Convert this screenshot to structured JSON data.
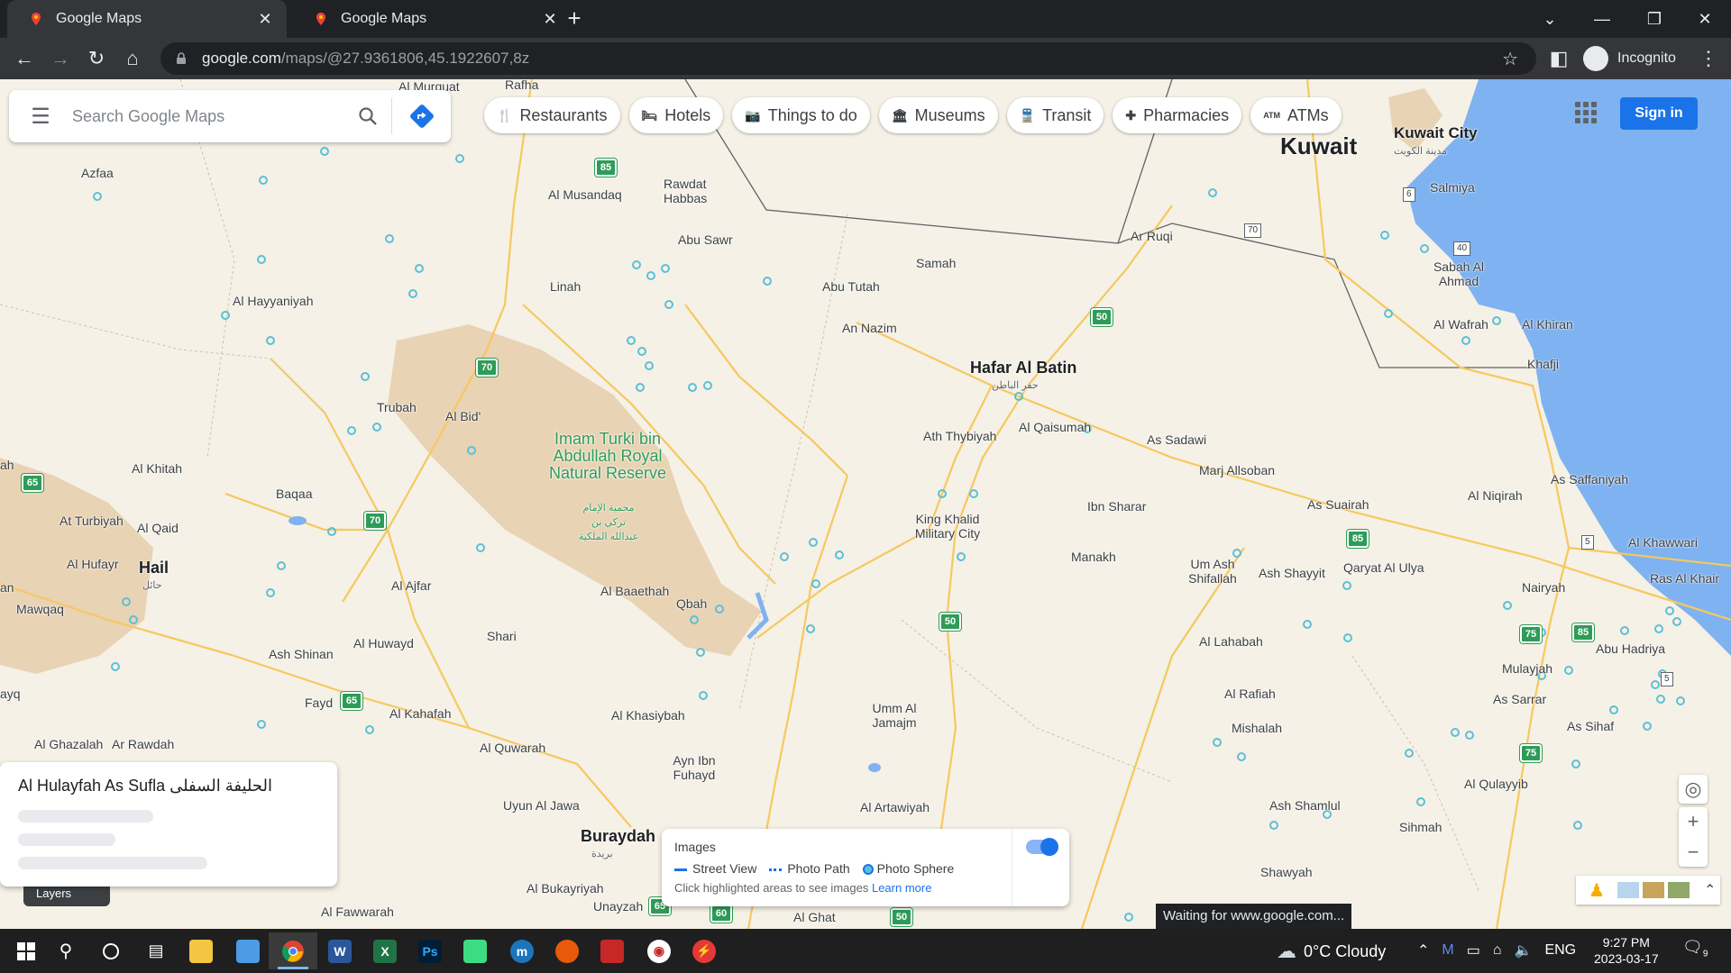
{
  "tabs": [
    {
      "title": "Google Maps",
      "active": true
    },
    {
      "title": "Google Maps",
      "active": false
    }
  ],
  "address": {
    "host": "google.com",
    "path": "/maps/@27.9361806,45.1922607,8z"
  },
  "profile": {
    "label": "Incognito"
  },
  "search": {
    "placeholder": "Search Google Maps"
  },
  "chips": [
    {
      "label": "Restaurants",
      "icon": "restaurant-icon",
      "glyph": "🍴"
    },
    {
      "label": "Hotels",
      "icon": "hotel-icon",
      "glyph": "🛏"
    },
    {
      "label": "Things to do",
      "icon": "camera-icon",
      "glyph": "📷"
    },
    {
      "label": "Museums",
      "icon": "museum-icon",
      "glyph": "🏛"
    },
    {
      "label": "Transit",
      "icon": "transit-icon",
      "glyph": "🚆"
    },
    {
      "label": "Pharmacies",
      "icon": "pharmacy-icon",
      "glyph": "✚"
    },
    {
      "label": "ATMs",
      "icon": "atm-icon",
      "glyph": "ATM"
    }
  ],
  "signin": {
    "label": "Sign in"
  },
  "map": {
    "labels": {
      "kuwait": "Kuwait",
      "kuwait_city": "Kuwait City",
      "kuwait_city_ar": "مدينة الكويت",
      "salmiya": "Salmiya",
      "hafar": "Hafar Al Batin",
      "hafar_ar": "حفر الباطن",
      "buraydah": "Buraydah",
      "buraydah_ar": "بريدة",
      "hail": "Hail",
      "hail_ar": "حائل",
      "park": "Imam Turki bin Abdullah Royal Natural Reserve",
      "park_ar": "محمية الإمام تركي بن عبدالله الملكية",
      "al_musandaq": "Al Musandaq",
      "rawdat_habbas": "Rawdat Habbas",
      "abu_sawr": "Abu Sawr",
      "linah": "Linah",
      "abu_tutah": "Abu Tutah",
      "samah": "Samah",
      "an_nazim": "An Nazim",
      "ar_ruqi": "Ar Ruqi",
      "al_qaisumah": "Al Qaisumah",
      "ath_thybiyah": "Ath Thybiyah",
      "as_sadawi": "As Sadawi",
      "marj_allsoban": "Marj Allsoban",
      "king_khalid": "King Khalid Military City",
      "ibn_sharar": "Ibn Sharar",
      "manakh": "Manakh",
      "um_ash_shifallah": "Um Ash Shifallah",
      "ash_shayyit": "Ash Shayyit",
      "qaryat_al_ulya": "Qaryat Al Ulya",
      "as_suairah": "As Suairah",
      "al_niqirah": "Al Niqirah",
      "as_saffaniyah": "As Saffaniyah",
      "al_khawwari": "Al Khawwari",
      "ras_al_khair": "Ras Al Khair",
      "nairyah": "Nairyah",
      "abu_hadriya": "Abu Hadriya",
      "mulayjah": "Mulayjah",
      "as_sarrar": "As Sarrar",
      "as_sihaf": "As Sihaf",
      "al_qulayyib": "Al Qulayyib",
      "sihmah": "Sihmah",
      "ash_shamlul": "Ash Shamlul",
      "shawyah": "Shawyah",
      "mishalah": "Mishalah",
      "al_rafiah": "Al Rafiah",
      "al_lahabah": "Al Lahabah",
      "umm_al_jamajm": "Umm Al Jamajm",
      "al_artawiyah": "Al Artawiyah",
      "al_ghat": "Al Ghat",
      "ayn_ibn_fuhayd": "Ayn Ibn Fuhayd",
      "al_khasiybah": "Al Khasiybah",
      "qbah": "Qbah",
      "al_baaethah": "Al Baaethah",
      "shari": "Shari",
      "al_quwarah": "Al Quwarah",
      "uyun_al_jawa": "Uyun Al Jawa",
      "al_bukayriyah": "Al Bukayriyah",
      "unayzah": "Unayzah",
      "al_fawwarah": "Al Fawwarah",
      "al_kahafah": "Al Kahafah",
      "fayd": "Fayd",
      "ash_shinan": "Ash Shinan",
      "al_huwayd": "Al Huwayd",
      "al_ajfar": "Al Ajfar",
      "baqaa": "Baqaa",
      "trubah": "Trubah",
      "al_bid": "Al Bid'",
      "al_khitah": "Al Khitah",
      "at_turbiyah": "At Turbiyah",
      "al_qaid": "Al Qaid",
      "al_hufayr": "Al Hufayr",
      "mawqaq": "Mawqaq",
      "al_ghazalah": "Al Ghazalah",
      "ar_rawdah": "Ar Rawdah",
      "azfaa": "Azfaa",
      "al_hayyaniyah": "Al Hayyaniyah",
      "al_murquat": "Al Murquat",
      "rafha": "Rafha",
      "sabah_al_ahmad": "Sabah Al Ahmad",
      "al_wafrah": "Al Wafrah",
      "al_khiran": "Al Khiran",
      "khafji": "Khafji",
      "hayq": "ayq",
      "ah": "ah",
      "an": "an"
    },
    "shields": [
      "85",
      "70",
      "70",
      "65",
      "65",
      "50",
      "50",
      "85",
      "85",
      "75",
      "75",
      "65",
      "60",
      "50"
    ],
    "boxes": [
      "70",
      "40",
      "6",
      "5",
      "5"
    ]
  },
  "placecard": {
    "title": "Al Hulayfah As Sufla الحليفة السفلى"
  },
  "layers": {
    "label": "Layers"
  },
  "images_panel": {
    "title": "Images",
    "legend": [
      "Street View",
      "Photo Path",
      "Photo Sphere"
    ],
    "hint": "Click highlighted areas to see images",
    "learn_more": "Learn more",
    "toggle_on": true
  },
  "status_bar": {
    "text": "Waiting for www.google.com..."
  },
  "taskbar": {
    "weather": "0°C  Cloudy",
    "language": "ENG",
    "time": "9:27 PM",
    "date": "2023-03-17",
    "notifications": "9"
  },
  "colors": {
    "land": "#f5f1e6",
    "water": "#7fb2f0",
    "road": "#f6c85f",
    "park": "#e9d3b5",
    "accent": "#1a73e8",
    "poi": "#5bc0d6"
  }
}
